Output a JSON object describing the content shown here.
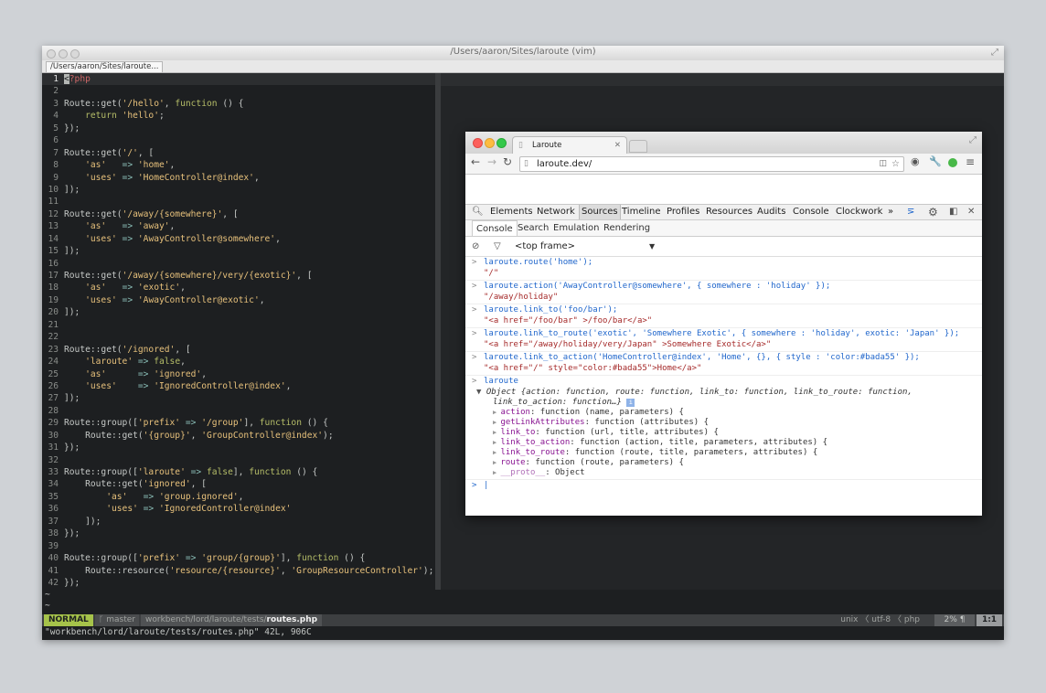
{
  "vim": {
    "window_title": "/Users/aaron/Sites/laroute (vim)",
    "tab_label": "/Users/aaron/Sites/laroute...",
    "lines": [
      {
        "n": "1",
        "t": [
          [
            "ph",
            "<"
          ],
          [
            "ph",
            "?php"
          ]
        ]
      },
      {
        "n": "2",
        "t": []
      },
      {
        "n": "3",
        "t": [
          [
            "pn",
            "Route::get("
          ],
          [
            "st",
            "'/hello'"
          ],
          [
            "pn",
            ", "
          ],
          [
            "kw",
            "function"
          ],
          [
            "pn",
            " () {"
          ]
        ]
      },
      {
        "n": "4",
        "t": [
          [
            "pn",
            "    "
          ],
          [
            "kw",
            "return"
          ],
          [
            "pn",
            " "
          ],
          [
            "st",
            "'hello'"
          ],
          [
            "pn",
            ";"
          ]
        ]
      },
      {
        "n": "5",
        "t": [
          [
            "pn",
            "});"
          ]
        ]
      },
      {
        "n": "6",
        "t": []
      },
      {
        "n": "7",
        "t": [
          [
            "pn",
            "Route::get("
          ],
          [
            "st",
            "'/'"
          ],
          [
            "pn",
            ", ["
          ]
        ]
      },
      {
        "n": "8",
        "t": [
          [
            "pn",
            "    "
          ],
          [
            "st",
            "'as'"
          ],
          [
            "pn",
            "   "
          ],
          [
            "op",
            "=>"
          ],
          [
            "pn",
            " "
          ],
          [
            "st",
            "'home'"
          ],
          [
            "pn",
            ","
          ]
        ]
      },
      {
        "n": "9",
        "t": [
          [
            "pn",
            "    "
          ],
          [
            "st",
            "'uses'"
          ],
          [
            "pn",
            " "
          ],
          [
            "op",
            "=>"
          ],
          [
            "pn",
            " "
          ],
          [
            "st",
            "'HomeController@index'"
          ],
          [
            "pn",
            ","
          ]
        ]
      },
      {
        "n": "10",
        "t": [
          [
            "pn",
            "]);"
          ]
        ]
      },
      {
        "n": "11",
        "t": []
      },
      {
        "n": "12",
        "t": [
          [
            "pn",
            "Route::get("
          ],
          [
            "st",
            "'/away/{somewhere}'"
          ],
          [
            "pn",
            ", ["
          ]
        ]
      },
      {
        "n": "13",
        "t": [
          [
            "pn",
            "    "
          ],
          [
            "st",
            "'as'"
          ],
          [
            "pn",
            "   "
          ],
          [
            "op",
            "=>"
          ],
          [
            "pn",
            " "
          ],
          [
            "st",
            "'away'"
          ],
          [
            "pn",
            ","
          ]
        ]
      },
      {
        "n": "14",
        "t": [
          [
            "pn",
            "    "
          ],
          [
            "st",
            "'uses'"
          ],
          [
            "pn",
            " "
          ],
          [
            "op",
            "=>"
          ],
          [
            "pn",
            " "
          ],
          [
            "st",
            "'AwayController@somewhere'"
          ],
          [
            "pn",
            ","
          ]
        ]
      },
      {
        "n": "15",
        "t": [
          [
            "pn",
            "]);"
          ]
        ]
      },
      {
        "n": "16",
        "t": []
      },
      {
        "n": "17",
        "t": [
          [
            "pn",
            "Route::get("
          ],
          [
            "st",
            "'/away/{somewhere}/very/{exotic}'"
          ],
          [
            "pn",
            ", ["
          ]
        ]
      },
      {
        "n": "18",
        "t": [
          [
            "pn",
            "    "
          ],
          [
            "st",
            "'as'"
          ],
          [
            "pn",
            "   "
          ],
          [
            "op",
            "=>"
          ],
          [
            "pn",
            " "
          ],
          [
            "st",
            "'exotic'"
          ],
          [
            "pn",
            ","
          ]
        ]
      },
      {
        "n": "19",
        "t": [
          [
            "pn",
            "    "
          ],
          [
            "st",
            "'uses'"
          ],
          [
            "pn",
            " "
          ],
          [
            "op",
            "=>"
          ],
          [
            "pn",
            " "
          ],
          [
            "st",
            "'AwayController@exotic'"
          ],
          [
            "pn",
            ","
          ]
        ]
      },
      {
        "n": "20",
        "t": [
          [
            "pn",
            "]);"
          ]
        ]
      },
      {
        "n": "21",
        "t": []
      },
      {
        "n": "22",
        "t": []
      },
      {
        "n": "23",
        "t": [
          [
            "pn",
            "Route::get("
          ],
          [
            "st",
            "'/ignored'"
          ],
          [
            "pn",
            ", ["
          ]
        ]
      },
      {
        "n": "24",
        "t": [
          [
            "pn",
            "    "
          ],
          [
            "st",
            "'laroute'"
          ],
          [
            "pn",
            " "
          ],
          [
            "op",
            "=>"
          ],
          [
            "pn",
            " "
          ],
          [
            "kw",
            "false"
          ],
          [
            "pn",
            ","
          ]
        ]
      },
      {
        "n": "25",
        "t": [
          [
            "pn",
            "    "
          ],
          [
            "st",
            "'as'"
          ],
          [
            "pn",
            "      "
          ],
          [
            "op",
            "=>"
          ],
          [
            "pn",
            " "
          ],
          [
            "st",
            "'ignored'"
          ],
          [
            "pn",
            ","
          ]
        ]
      },
      {
        "n": "26",
        "t": [
          [
            "pn",
            "    "
          ],
          [
            "st",
            "'uses'"
          ],
          [
            "pn",
            "    "
          ],
          [
            "op",
            "=>"
          ],
          [
            "pn",
            " "
          ],
          [
            "st",
            "'IgnoredController@index'"
          ],
          [
            "pn",
            ","
          ]
        ]
      },
      {
        "n": "27",
        "t": [
          [
            "pn",
            "]);"
          ]
        ]
      },
      {
        "n": "28",
        "t": []
      },
      {
        "n": "29",
        "t": [
          [
            "pn",
            "Route::group(["
          ],
          [
            "st",
            "'prefix'"
          ],
          [
            "pn",
            " "
          ],
          [
            "op",
            "=>"
          ],
          [
            "pn",
            " "
          ],
          [
            "st",
            "'/group'"
          ],
          [
            "pn",
            "], "
          ],
          [
            "kw",
            "function"
          ],
          [
            "pn",
            " () {"
          ]
        ]
      },
      {
        "n": "30",
        "t": [
          [
            "pn",
            "    Route::get("
          ],
          [
            "st",
            "'{group}'"
          ],
          [
            "pn",
            ", "
          ],
          [
            "st",
            "'GroupController@index'"
          ],
          [
            "pn",
            ");"
          ]
        ]
      },
      {
        "n": "31",
        "t": [
          [
            "pn",
            "});"
          ]
        ]
      },
      {
        "n": "32",
        "t": []
      },
      {
        "n": "33",
        "t": [
          [
            "pn",
            "Route::group(["
          ],
          [
            "st",
            "'laroute'"
          ],
          [
            "pn",
            " "
          ],
          [
            "op",
            "=>"
          ],
          [
            "pn",
            " "
          ],
          [
            "kw",
            "false"
          ],
          [
            "pn",
            "], "
          ],
          [
            "kw",
            "function"
          ],
          [
            "pn",
            " () {"
          ]
        ]
      },
      {
        "n": "34",
        "t": [
          [
            "pn",
            "    Route::get("
          ],
          [
            "st",
            "'ignored'"
          ],
          [
            "pn",
            ", ["
          ]
        ]
      },
      {
        "n": "35",
        "t": [
          [
            "pn",
            "        "
          ],
          [
            "st",
            "'as'"
          ],
          [
            "pn",
            "   "
          ],
          [
            "op",
            "=>"
          ],
          [
            "pn",
            " "
          ],
          [
            "st",
            "'group.ignored'"
          ],
          [
            "pn",
            ","
          ]
        ]
      },
      {
        "n": "36",
        "t": [
          [
            "pn",
            "        "
          ],
          [
            "st",
            "'uses'"
          ],
          [
            "pn",
            " "
          ],
          [
            "op",
            "=>"
          ],
          [
            "pn",
            " "
          ],
          [
            "st",
            "'IgnoredController@index'"
          ]
        ]
      },
      {
        "n": "37",
        "t": [
          [
            "pn",
            "    ]);"
          ]
        ]
      },
      {
        "n": "38",
        "t": [
          [
            "pn",
            "});"
          ]
        ]
      },
      {
        "n": "39",
        "t": []
      },
      {
        "n": "40",
        "t": [
          [
            "pn",
            "Route::group(["
          ],
          [
            "st",
            "'prefix'"
          ],
          [
            "pn",
            " "
          ],
          [
            "op",
            "=>"
          ],
          [
            "pn",
            " "
          ],
          [
            "st",
            "'group/{group}'"
          ],
          [
            "pn",
            "], "
          ],
          [
            "kw",
            "function"
          ],
          [
            "pn",
            " () {"
          ]
        ]
      },
      {
        "n": "41",
        "t": [
          [
            "pn",
            "    Route::resource("
          ],
          [
            "st",
            "'resource/{resource}'"
          ],
          [
            "pn",
            ", "
          ],
          [
            "st",
            "'GroupResourceController'"
          ],
          [
            "pn",
            ");"
          ]
        ]
      },
      {
        "n": "42",
        "t": [
          [
            "pn",
            "});"
          ]
        ]
      }
    ],
    "tilde": "~",
    "status": {
      "mode": "NORMAL",
      "branch": "master",
      "path_prefix": "workbench/lord/laroute/tests/",
      "filename": "routes.php",
      "fileformat": "unix",
      "encoding": "utf-8",
      "filetype": "php",
      "percent": "2%",
      "position": "1:1"
    },
    "cmdline": "\"workbench/lord/laroute/tests/routes.php\" 42L, 906C"
  },
  "chrome": {
    "tab_title": "Laroute",
    "url": "laroute.dev/",
    "devtools_tabs": [
      "Elements",
      "Network",
      "Sources",
      "Timeline",
      "Profiles",
      "Resources",
      "Audits",
      "Console",
      "Clockwork"
    ],
    "more": "»",
    "subtabs": [
      "Console",
      "Search",
      "Emulation",
      "Rendering"
    ],
    "frame": "<top frame>",
    "console": [
      {
        "in": "laroute.route('home');",
        "out": "\"/\""
      },
      {
        "in": "laroute.action('AwayController@somewhere', { somewhere : 'holiday' });",
        "out": "\"/away/holiday\""
      },
      {
        "in": "laroute.link_to('foo/bar');",
        "out": "\"<a href=\"/foo/bar\" >/foo/bar</a>\""
      },
      {
        "in": "laroute.link_to_route('exotic', 'Somewhere Exotic', { somewhere : 'holiday', exotic: 'Japan' });",
        "out": "\"<a href=\"/away/holiday/very/Japan\" >Somewhere Exotic</a>\""
      },
      {
        "in": "laroute.link_to_action('HomeController@index', 'Home', {}, { style : 'color:#bada55' });",
        "out": "\"<a href=\"/\" style=\"color:#bada55\">Home</a>\""
      }
    ],
    "last_input": "laroute",
    "object_summary_1": "Object {action: function, route: function, link_to: function, link_to_route: function,",
    "object_summary_2": "link_to_action: function…}",
    "props": [
      {
        "k": "action",
        "v": ": function (name, parameters) {"
      },
      {
        "k": "getLinkAttributes",
        "v": ": function (attributes) {"
      },
      {
        "k": "link_to",
        "v": ": function (url, title, attributes) {"
      },
      {
        "k": "link_to_action",
        "v": ": function (action, title, parameters, attributes) {"
      },
      {
        "k": "link_to_route",
        "v": ": function (route, title, parameters, attributes) {"
      },
      {
        "k": "route",
        "v": ": function (route, parameters) {"
      },
      {
        "k": "__proto__",
        "v": ": Object"
      }
    ]
  }
}
